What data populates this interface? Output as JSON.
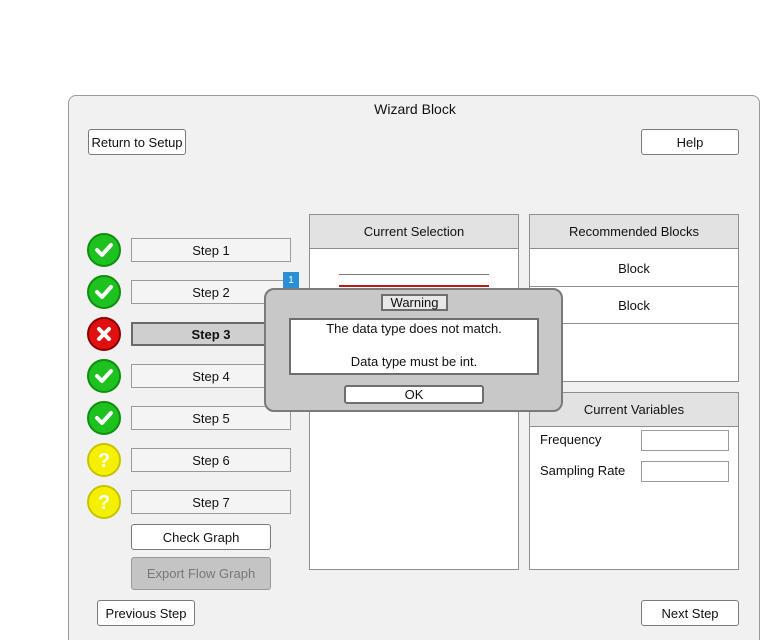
{
  "window": {
    "title": "Wizard Block"
  },
  "header": {
    "return_label": "Return to Setup",
    "help_label": "Help"
  },
  "steps": [
    {
      "label": "Step 1",
      "status": "complete",
      "icon": "check-icon"
    },
    {
      "label": "Step 2",
      "status": "complete",
      "icon": "check-icon"
    },
    {
      "label": "Step 3",
      "status": "error",
      "icon": "x-icon"
    },
    {
      "label": "Step 4",
      "status": "complete",
      "icon": "check-icon"
    },
    {
      "label": "Step 5",
      "status": "complete",
      "icon": "check-icon"
    },
    {
      "label": "Step 6",
      "status": "unknown",
      "icon": "question-icon"
    },
    {
      "label": "Step 7",
      "status": "unknown",
      "icon": "question-icon"
    }
  ],
  "actions": {
    "check_graph_label": "Check Graph",
    "export_flow_graph_label": "Export Flow Graph"
  },
  "current_selection": {
    "title": "Current Selection",
    "badge": "1"
  },
  "recommended": {
    "title": "Recommended Blocks",
    "items": [
      "Block",
      "Block"
    ]
  },
  "variables": {
    "title": "Current Variables",
    "fields": [
      {
        "label": "Frequency",
        "value": ""
      },
      {
        "label": "Sampling Rate",
        "value": ""
      }
    ]
  },
  "dialog": {
    "title": "Warning",
    "line1": "The data type does not match.",
    "line2": "Data type must be int.",
    "ok_label": "OK"
  },
  "footer": {
    "previous_label": "Previous Step",
    "next_label": "Next Step"
  },
  "colors": {
    "complete": "#1ec21e",
    "error": "#e01010",
    "unknown": "#f5f000",
    "badge": "#2a8fd6",
    "selection_line": "#c01818"
  }
}
